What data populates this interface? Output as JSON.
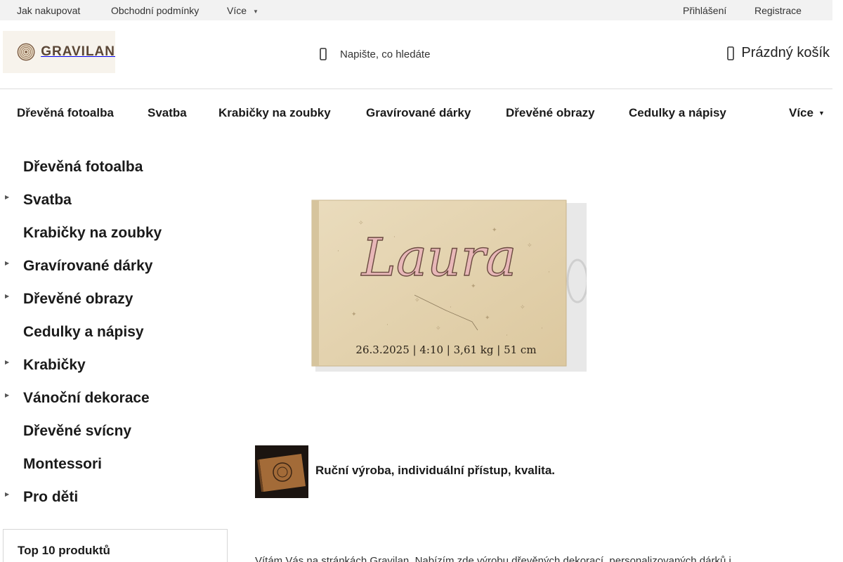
{
  "topbar": {
    "links": [
      "Jak nakupovat",
      "Obchodní podmínky",
      "Více"
    ],
    "login": "Přihlášení",
    "register": "Registrace"
  },
  "header": {
    "logo_text": "GRAVILAN",
    "search_placeholder": "Napište, co hledáte",
    "cart_label": "Prázdný košík"
  },
  "main_nav": {
    "items": [
      "Dřevěná fotoalba",
      "Svatba",
      "Krabičky na zoubky",
      "Gravírované dárky",
      "Dřevěné obrazy",
      "Cedulky a nápisy",
      "Více"
    ]
  },
  "sidebar": {
    "items": [
      "Dřevěná fotoalba",
      "Svatba",
      "Krabičky na zoubky",
      "Gravírované dárky",
      "Dřevěné obrazy",
      "Cedulky a nápisy",
      "Krabičky",
      "Vánoční dekorace",
      "Dřevěné svícny",
      "Montessori",
      "Pro děti"
    ],
    "top10_title": "Top 10 produktů"
  },
  "hero": {
    "name_text": "Laura",
    "birth_info": "26.3.2025 | 4:10 | 3,61 kg | 51 cm"
  },
  "feature": {
    "text": "Ruční výroba, individuální přístup, kvalita."
  },
  "intro": {
    "text": "Vítám Vás na stránkách Gravilan. Nabízím zde výrobu dřevěných dekorací, personalizovaných dárků i"
  }
}
